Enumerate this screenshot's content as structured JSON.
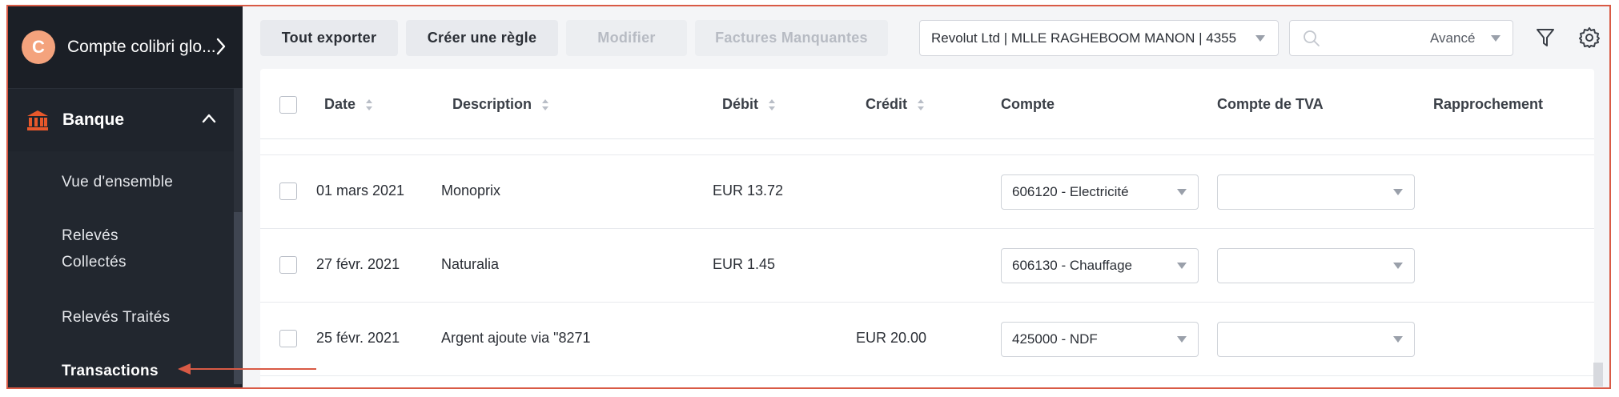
{
  "sidebar": {
    "account": {
      "initial": "C",
      "name": "Compte colibri glo..."
    },
    "section": {
      "label": "Banque"
    },
    "items": [
      {
        "label_line1": "Vue d'ensemble"
      },
      {
        "label_line1": "Relevés",
        "label_line2": "Collectés"
      },
      {
        "label_line1": "Relevés Traités"
      },
      {
        "label_line1": "Transactions"
      }
    ]
  },
  "toolbar": {
    "export_label": "Tout exporter",
    "create_rule_label": "Créer une règle",
    "modify_label": "Modifier",
    "missing_invoices_label": "Factures Manquantes",
    "account_select": "Revolut Ltd | MLLE RAGHEBOOM MANON | 4355",
    "search_placeholder": "",
    "advanced_label": "Avancé"
  },
  "table": {
    "headers": {
      "date": "Date",
      "description": "Description",
      "debit": "Débit",
      "credit": "Crédit",
      "account": "Compte",
      "vat_account": "Compte de TVA",
      "reconciliation": "Rapprochement"
    },
    "rows": [
      {
        "date": "01 mars 2021",
        "description": "Monoprix",
        "debit": "EUR 13.72",
        "credit": "",
        "account": "606120 - Electricité",
        "vat": ""
      },
      {
        "date": "27 févr. 2021",
        "description": "Naturalia",
        "debit": "EUR 1.45",
        "credit": "",
        "account": "606130 - Chauffage",
        "vat": ""
      },
      {
        "date": "25 févr. 2021",
        "description": "Argent ajoute via \"8271",
        "debit": "",
        "credit": "EUR 20.00",
        "account": "425000 - NDF",
        "vat": ""
      }
    ]
  },
  "colors": {
    "accent": "#d95a45",
    "sidebar_bg": "#1b1f26",
    "bank_icon": "#e8582b",
    "avatar": "#f4a37d"
  }
}
